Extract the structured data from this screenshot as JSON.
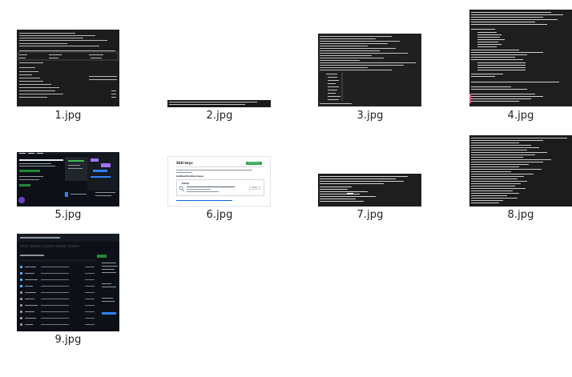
{
  "gallery": {
    "items": [
      {
        "filename": "1.jpg"
      },
      {
        "filename": "2.jpg"
      },
      {
        "filename": "3.jpg"
      },
      {
        "filename": "4.jpg"
      },
      {
        "filename": "5.jpg"
      },
      {
        "filename": "6.jpg"
      },
      {
        "filename": "7.jpg"
      },
      {
        "filename": "8.jpg"
      },
      {
        "filename": "9.jpg"
      }
    ],
    "thumb_6": {
      "title": "SSH keys",
      "button": "New SSH key",
      "section": "Authentication keys",
      "key_name": "Hdrip",
      "delete": "Delete"
    }
  }
}
